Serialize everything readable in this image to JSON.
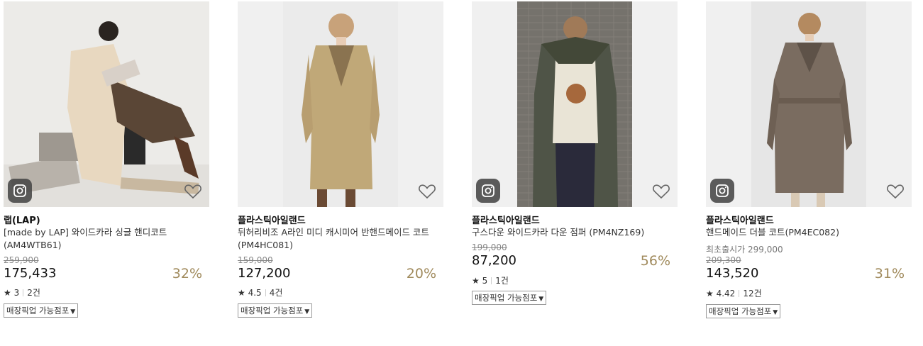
{
  "products": [
    {
      "brand": "랩(LAP)",
      "name": "[made by LAP] 와이드카라 싱글 핸디코트(AM4WTB61)",
      "first_release": "",
      "original_price": "259,900",
      "price": "175,433",
      "discount": "32%",
      "rating": "3",
      "review_count": "2건",
      "pickup_label": "매장픽업 가능점포",
      "has_instagram_badge": true,
      "image_bg": "#ecebe8"
    },
    {
      "brand": "플라스틱아일랜드",
      "name": "뒤허리비조 A라인 미디 캐시미어 반핸드메이드 코트(PM4HC081)",
      "first_release": "",
      "original_price": "159,000",
      "price": "127,200",
      "discount": "20%",
      "rating": "4.5",
      "review_count": "4건",
      "pickup_label": "매장픽업 가능점포",
      "has_instagram_badge": false,
      "image_bg": "#eeeeee"
    },
    {
      "brand": "플라스틱아일랜드",
      "name": "구스다운 와이드카라 다운 점퍼 (PM4NZ169)",
      "first_release": "",
      "original_price": "199,000",
      "price": "87,200",
      "discount": "56%",
      "rating": "5",
      "review_count": "1건",
      "pickup_label": "매장픽업 가능점포",
      "has_instagram_badge": true,
      "image_bg": "#6f6c66"
    },
    {
      "brand": "플라스틱아일랜드",
      "name": "핸드메이드 더블 코트(PM4EC082)",
      "first_release": "최초출시가 299,000",
      "original_price": "209,300",
      "price": "143,520",
      "discount": "31%",
      "rating": "4.42",
      "review_count": "12건",
      "pickup_label": "매장픽업 가능점포",
      "has_instagram_badge": true,
      "image_bg": "#eaeaea"
    }
  ],
  "icons": {
    "star": "star-icon",
    "heart": "heart-icon",
    "instagram": "instagram-icon",
    "caret": "caret-down-icon"
  },
  "colors": {
    "discount": "#a08a5c",
    "star": "#222222"
  }
}
